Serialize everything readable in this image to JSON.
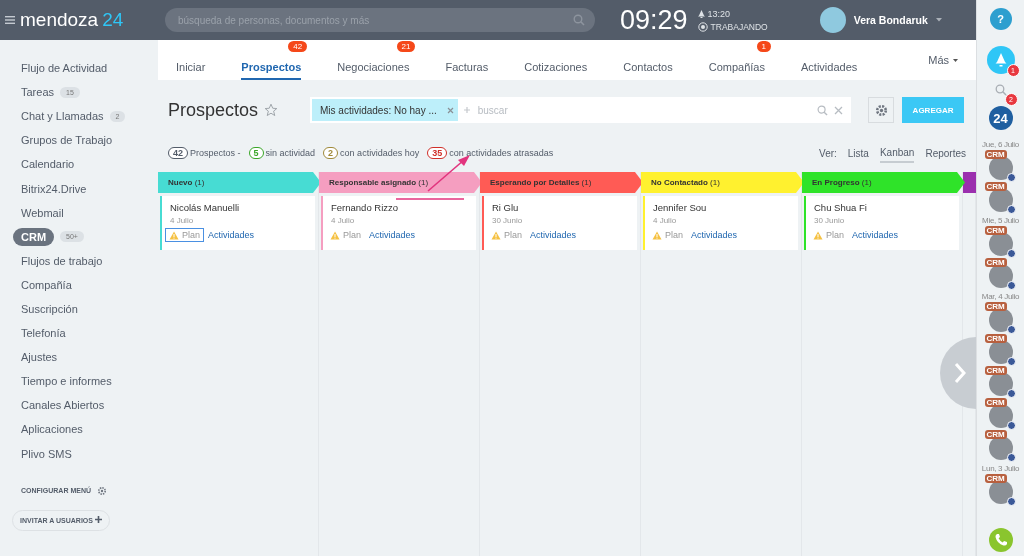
{
  "header": {
    "logo_text": "mendoza",
    "logo_number": "24",
    "search_placeholder": "búsqueda de personas, documentos y más",
    "time": "09:29",
    "alarm": "13:20",
    "status": "TRABAJANDO",
    "user": "Vera Bondaruk",
    "help": "?"
  },
  "sidebar": {
    "items": [
      {
        "label": "Flujo de Actividad",
        "selected": false
      },
      {
        "label": "Tareas",
        "counter": "15",
        "selected": false
      },
      {
        "label": "Chat y Llamadas",
        "counter": "2",
        "selected": false
      },
      {
        "label": "Grupos de Trabajo",
        "selected": false
      },
      {
        "label": "Calendario",
        "selected": false
      },
      {
        "label": "Bitrix24.Drive",
        "selected": false
      },
      {
        "label": "Webmail",
        "selected": false
      },
      {
        "label": "CRM",
        "counter": "50+",
        "selected": true
      },
      {
        "label": "Flujos de trabajo",
        "selected": false
      },
      {
        "label": "Compañía",
        "selected": false
      },
      {
        "label": "Suscripción",
        "selected": false
      },
      {
        "label": "Telefonía",
        "selected": false
      },
      {
        "label": "Ajustes",
        "selected": false
      },
      {
        "label": "Tiempo e informes",
        "selected": false
      },
      {
        "label": "Canales Abiertos",
        "selected": false
      },
      {
        "label": "Aplicaciones",
        "selected": false
      },
      {
        "label": "Plivo SMS",
        "selected": false
      }
    ],
    "configure": "CONFIGURAR MENÚ",
    "invite": "INVITAR A USUARIOS"
  },
  "tabs": [
    {
      "label": "Iniciar",
      "selected": false
    },
    {
      "label": "Prospectos",
      "counter": "42",
      "selected": true
    },
    {
      "label": "Negociaciones",
      "counter": "21",
      "selected": false
    },
    {
      "label": "Facturas",
      "selected": false
    },
    {
      "label": "Cotizaciones",
      "selected": false
    },
    {
      "label": "Contactos",
      "selected": false
    },
    {
      "label": "Compañías",
      "counter": "1",
      "selected": false
    },
    {
      "label": "Actividades",
      "selected": false
    }
  ],
  "more": "Más",
  "page": {
    "title": "Prospectos",
    "filter_chip": "Mis actividades: No hay ...",
    "search_placeholder": "buscar",
    "add_button": "AGREGAR"
  },
  "stats": [
    {
      "count": "42",
      "label": "Prospectos -",
      "color": "#535c69"
    },
    {
      "count": "5",
      "label": "sin actividad",
      "color": "#3aa628"
    },
    {
      "count": "2",
      "label": "con actividades hoy",
      "color": "#a08a3a"
    },
    {
      "count": "35",
      "label": "con actividades atrasadas",
      "color": "#d0302a"
    }
  ],
  "views": {
    "label": "Ver:",
    "options": [
      {
        "label": "Lista",
        "selected": false
      },
      {
        "label": "Kanban",
        "selected": true
      },
      {
        "label": "Reportes",
        "selected": false
      }
    ]
  },
  "columns": [
    {
      "title": "Nuevo",
      "count": "(1)",
      "color": "#47dcd3",
      "cards": [
        {
          "name": "Nicolás Manuelli",
          "date": "4 Julio",
          "plan": "Plan",
          "link": "Actividades",
          "outlined": true
        }
      ]
    },
    {
      "title": "Responsable asignado",
      "count": "(1)",
      "color": "#f59ec0",
      "cards": [
        {
          "name": "Fernando Rizzo",
          "date": "4 Julio",
          "plan": "Plan",
          "link": "Actividades",
          "outlined": false
        }
      ]
    },
    {
      "title": "Esperando por Detalles",
      "count": "(1)",
      "color": "#ff5b55",
      "cards": [
        {
          "name": "Ri Glu",
          "date": "30 Junio",
          "plan": "Plan",
          "link": "Actividades",
          "outlined": false
        }
      ]
    },
    {
      "title": "No Contactado",
      "count": "(1)",
      "color": "#fff12f",
      "cards": [
        {
          "name": "Jennifer Sou",
          "date": "4 Julio",
          "plan": "Plan",
          "link": "Actividades",
          "outlined": false
        }
      ]
    },
    {
      "title": "En Progreso",
      "count": "(1)",
      "color": "#2fe329",
      "cards": [
        {
          "name": "Chu Shua Fi",
          "date": "30 Junio",
          "plan": "Plan",
          "link": "Actividades",
          "outlined": false
        }
      ]
    },
    {
      "color": "#9b2fae"
    }
  ],
  "right_panel": {
    "notifications": "1",
    "logo": "24",
    "logo_badge": "2",
    "groups": [
      {
        "date": "Jue, 6 Julio",
        "contacts": [
          {
            "tag": "CRM"
          },
          {
            "tag": "CRM"
          }
        ]
      },
      {
        "date": "Mie, 5 Julio",
        "contacts": [
          {
            "tag": "CRM"
          },
          {
            "tag": "CRM"
          }
        ]
      },
      {
        "date": "Mar, 4 Julio",
        "contacts": [
          {
            "tag": "CRM"
          },
          {
            "tag": "CRM"
          },
          {
            "tag": "CRM"
          },
          {
            "tag": "CRM"
          },
          {
            "tag": "CRM"
          }
        ]
      },
      {
        "date": "Lun, 3 Julio",
        "contacts": [
          {
            "tag": "CRM"
          }
        ]
      }
    ]
  }
}
